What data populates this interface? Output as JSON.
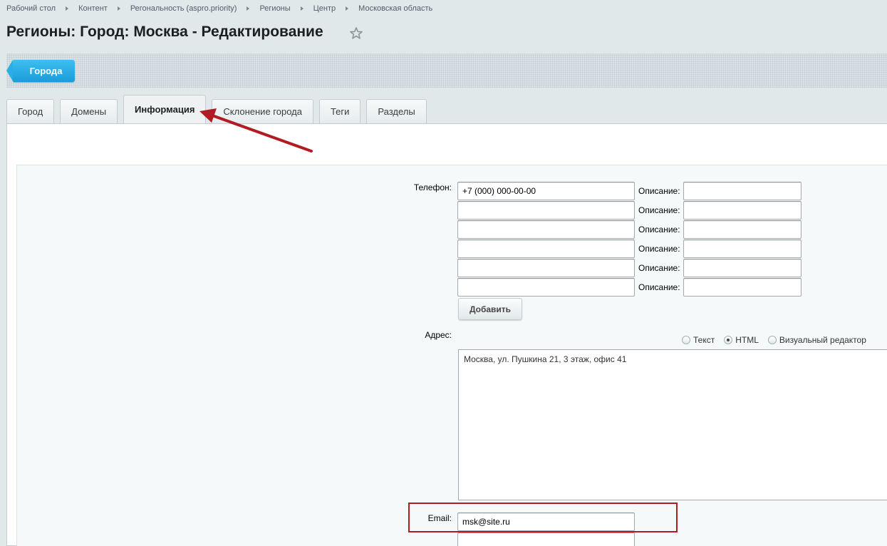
{
  "breadcrumb": [
    "Рабочий стол",
    "Контент",
    "Регональность (aspro.priority)",
    "Регионы",
    "Центр",
    "Московская область"
  ],
  "page_title": "Регионы: Город: Москва - Редактирование",
  "toolbar": {
    "back_label": "Города"
  },
  "tabs": [
    "Город",
    "Домены",
    "Информация",
    "Склонение города",
    "Теги",
    "Разделы"
  ],
  "active_tab": "Информация",
  "form": {
    "phone_label": "Телефон:",
    "description_label": "Описание:",
    "phones": [
      {
        "value": "+7 (000) 000-00-00",
        "description": ""
      },
      {
        "value": "",
        "description": ""
      },
      {
        "value": "",
        "description": ""
      },
      {
        "value": "",
        "description": ""
      },
      {
        "value": "",
        "description": ""
      },
      {
        "value": "",
        "description": ""
      }
    ],
    "add_button": "Добавить",
    "address_label": "Адрес:",
    "editor_modes": [
      "Текст",
      "HTML",
      "Визуальный редактор"
    ],
    "editor_mode_selected": "HTML",
    "address_value": "Москва, ул. Пушкина 21, 3 этаж, офис 41",
    "email_label": "Email:",
    "email_value": "msk@site.ru",
    "email_extra_value": ""
  },
  "colors": {
    "accent_blue": "#1a9cd8",
    "annotation_red": "#b01c22"
  },
  "icons": {
    "favorite": "star-outline-icon"
  }
}
